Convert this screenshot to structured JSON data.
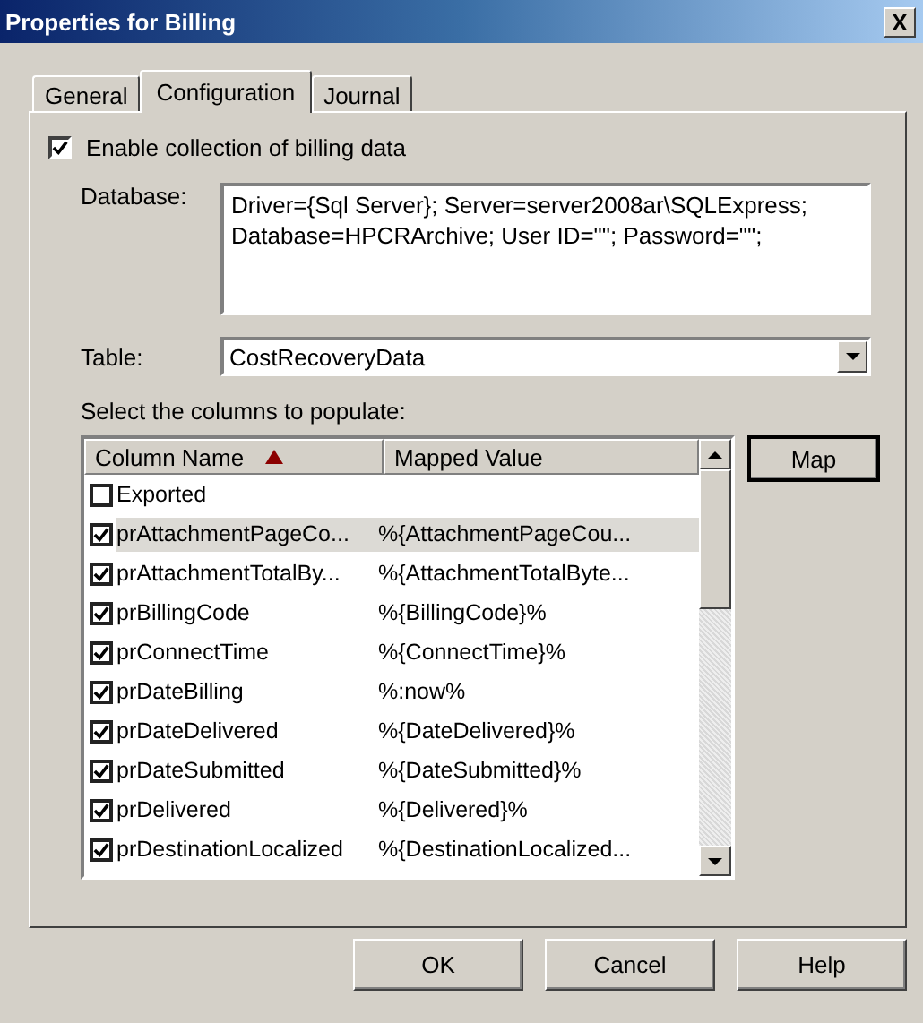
{
  "window": {
    "title": "Properties for Billing",
    "close": "X"
  },
  "tabs": [
    {
      "label": "General",
      "selected": false
    },
    {
      "label": "Configuration",
      "selected": true
    },
    {
      "label": "Journal",
      "selected": false
    }
  ],
  "enable": {
    "label": "Enable collection of billing data",
    "checked": true
  },
  "database": {
    "label": "Database:",
    "value": "Driver={Sql Server}; Server=server2008ar\\SQLExpress; Database=HPCRArchive; User ID=\"\"; Password=\"\";"
  },
  "table": {
    "label": "Table:",
    "value": "CostRecoveryData"
  },
  "columns_prompt": "Select the columns to populate:",
  "list": {
    "columns": [
      "Column Name",
      "Mapped Value"
    ],
    "rows": [
      {
        "name": "Exported",
        "value": "",
        "checked": false,
        "selected": false
      },
      {
        "name": "prAttachmentPageCo...",
        "value": "%{AttachmentPageCou...",
        "checked": true,
        "selected": true
      },
      {
        "name": "prAttachmentTotalBy...",
        "value": "%{AttachmentTotalByte...",
        "checked": true,
        "selected": false
      },
      {
        "name": "prBillingCode",
        "value": "%{BillingCode}%",
        "checked": true,
        "selected": false
      },
      {
        "name": "prConnectTime",
        "value": "%{ConnectTime}%",
        "checked": true,
        "selected": false
      },
      {
        "name": "prDateBilling",
        "value": "%:now%",
        "checked": true,
        "selected": false
      },
      {
        "name": "prDateDelivered",
        "value": "%{DateDelivered}%",
        "checked": true,
        "selected": false
      },
      {
        "name": "prDateSubmitted",
        "value": "%{DateSubmitted}%",
        "checked": true,
        "selected": false
      },
      {
        "name": "prDelivered",
        "value": "%{Delivered}%",
        "checked": true,
        "selected": false
      },
      {
        "name": "prDestinationLocalized",
        "value": "%{DestinationLocalized...",
        "checked": true,
        "selected": false
      }
    ]
  },
  "map_button": "Map",
  "buttons": [
    "OK",
    "Cancel",
    "Help"
  ]
}
